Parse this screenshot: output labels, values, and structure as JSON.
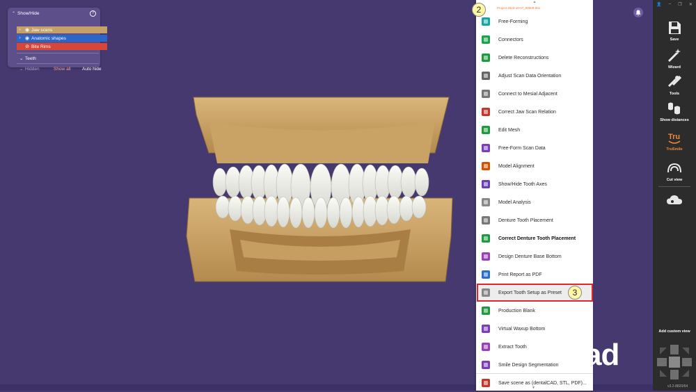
{
  "show_hide": {
    "title": "Show/Hide",
    "items": [
      {
        "label": "Jaw scans"
      },
      {
        "label": "Anatomic shapes"
      },
      {
        "label": "Bite Rims"
      }
    ],
    "teeth_label": "Teeth",
    "hidden_label": "Hidden",
    "show_all": "Show all",
    "auto_hide": "Auto hide"
  },
  "menu": {
    "header": "Project 2023-10-07_00009-001",
    "items": [
      {
        "label": "Free-Forming",
        "icon": "free-forming-icon"
      },
      {
        "label": "Connectors",
        "icon": "connectors-icon"
      },
      {
        "label": "Delete Reconstructions",
        "icon": "trash-icon"
      },
      {
        "label": "Adjust Scan Data Orientation",
        "icon": "orientation-icon"
      },
      {
        "label": "Connect to Mesial Adjacent",
        "icon": "mesial-icon"
      },
      {
        "label": "Correct Jaw Scan Relation",
        "icon": "jaw-relation-icon"
      },
      {
        "label": "Edit Mesh",
        "icon": "edit-mesh-icon"
      },
      {
        "label": "Free-Form Scan Data",
        "icon": "freeform-scan-icon"
      },
      {
        "label": "Model Alignment",
        "icon": "model-alignment-icon"
      },
      {
        "label": "Show/Hide Tooth Axes",
        "icon": "tooth-axes-icon"
      },
      {
        "label": "Model Analysis",
        "icon": "model-analysis-icon"
      },
      {
        "label": "Denture Tooth Placement",
        "icon": "tooth-placement-icon"
      },
      {
        "label": "Correct Denture Tooth Placement",
        "icon": "correct-placement-icon"
      },
      {
        "label": "Design Denture Base Bottom",
        "icon": "base-bottom-icon"
      },
      {
        "label": "Print Report as PDF",
        "icon": "pdf-icon"
      },
      {
        "label": "Export Tooth Setup as Preset",
        "icon": "export-preset-icon"
      },
      {
        "label": "Production Blank",
        "icon": "production-blank-icon"
      },
      {
        "label": "Virtual Waxup Bottom",
        "icon": "waxup-icon"
      },
      {
        "label": "Extract Tooth",
        "icon": "extract-tooth-icon"
      },
      {
        "label": "Smile Design Segmentation",
        "icon": "smile-segmentation-icon"
      },
      {
        "label": "Save scene as (dentalCAD, STL, PDF)...",
        "icon": "save-scene-icon"
      }
    ]
  },
  "callouts": {
    "first": "2",
    "second": "3"
  },
  "toolbar": {
    "buttons": [
      {
        "label": "Save",
        "icon": "save-icon"
      },
      {
        "label": "Wizard",
        "icon": "wizard-icon"
      },
      {
        "label": "Tools",
        "icon": "tools-icon"
      },
      {
        "label": "Show distances",
        "icon": "distances-icon"
      },
      {
        "label": "TruSmile",
        "icon": "trusmile-icon"
      },
      {
        "label": "Cut view",
        "icon": "cut-view-icon"
      }
    ],
    "add_custom_view": "Add custom view",
    "version": "v3.2-8820/64"
  },
  "brand": "ad",
  "colors": {
    "background": "#46396f",
    "accent": "#f08a3c",
    "highlight": "#e0262b"
  }
}
